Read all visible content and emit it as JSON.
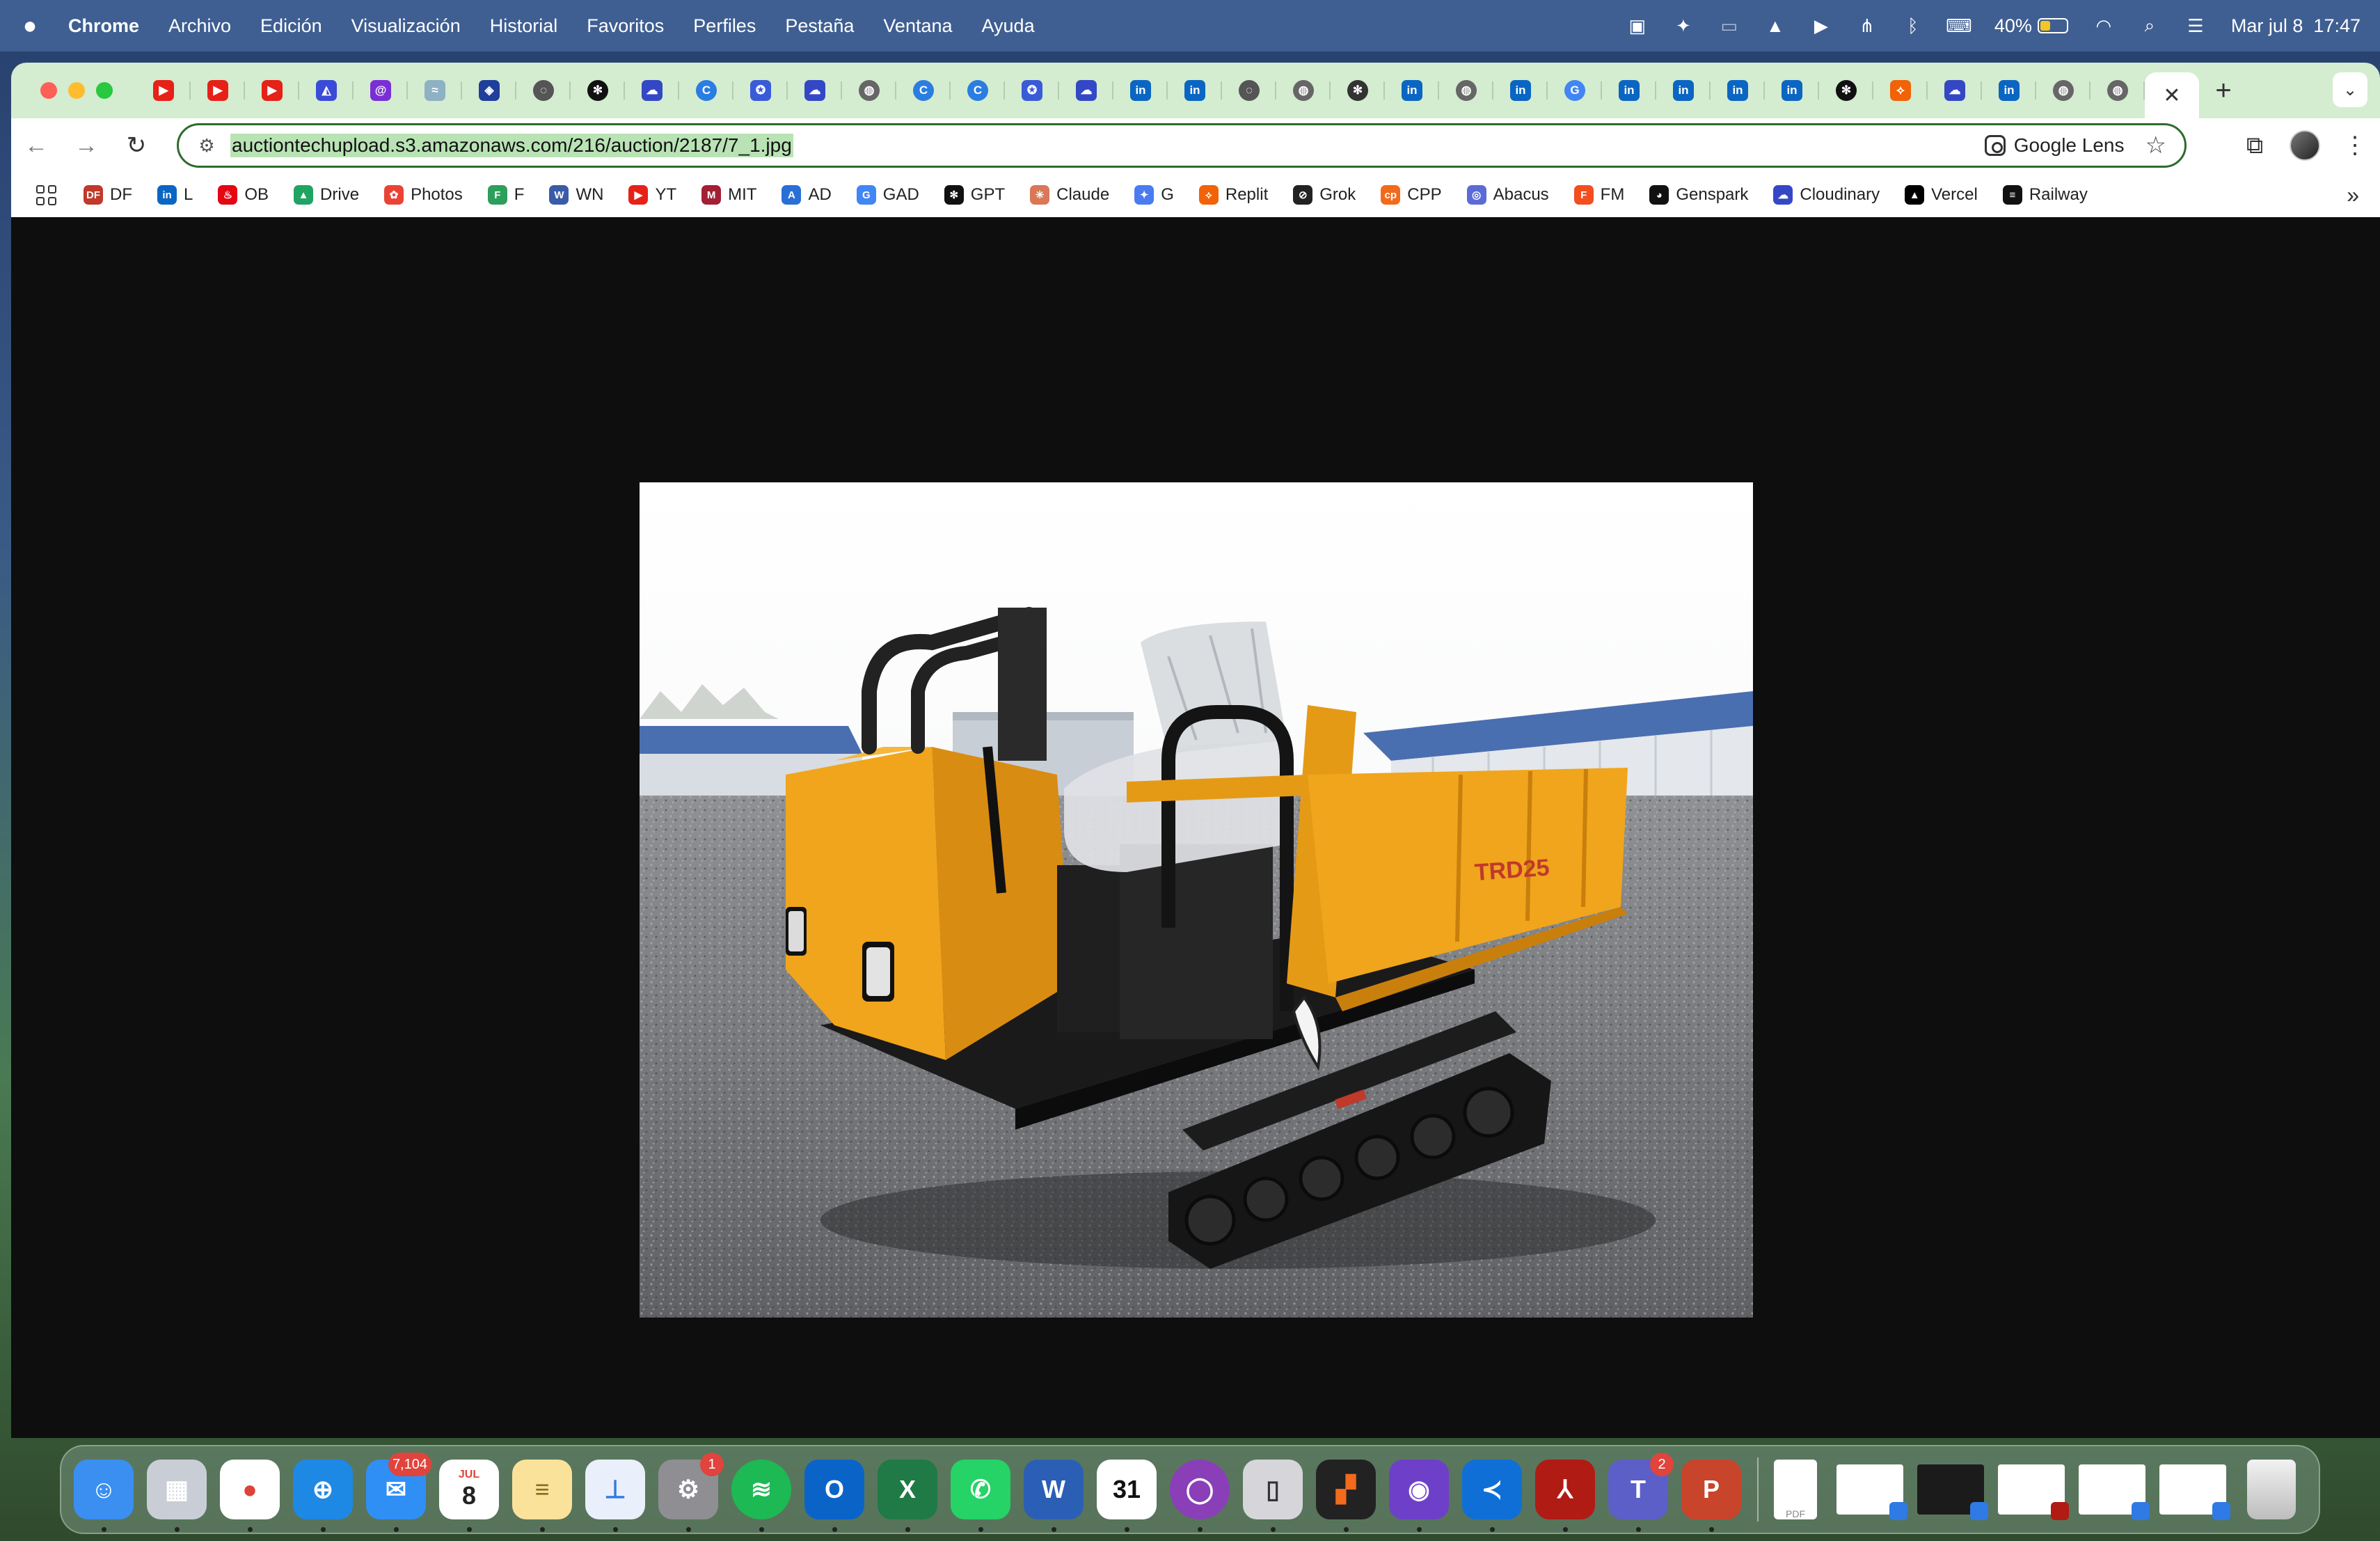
{
  "menubar": {
    "app_name": "Chrome",
    "menus": [
      "Archivo",
      "Edición",
      "Visualización",
      "Historial",
      "Favoritos",
      "Perfiles",
      "Pestaña",
      "Ventana",
      "Ayuda"
    ],
    "battery_percent": "40%",
    "battery_level": 0.4,
    "clock": "Mar jul 8  17:47"
  },
  "tabs": [
    {
      "icon": "youtube-icon",
      "color": "#e62117"
    },
    {
      "icon": "youtube-icon",
      "color": "#e62117"
    },
    {
      "icon": "youtube-icon",
      "color": "#e62117"
    },
    {
      "icon": "arc-icon",
      "color": "#3a4bd8"
    },
    {
      "icon": "spiral-icon",
      "color": "#7a2fd6"
    },
    {
      "icon": "wave-icon",
      "color": "#8fb1c4"
    },
    {
      "icon": "shield-app-icon",
      "color": "#1f3f9a"
    },
    {
      "icon": "loading-icon",
      "color": "#555555"
    },
    {
      "icon": "openai-icon",
      "color": "#111111"
    },
    {
      "icon": "cloudinary-icon",
      "color": "#3448c5"
    },
    {
      "icon": "c-app-icon",
      "color": "#2a7de1"
    },
    {
      "icon": "badge-icon",
      "color": "#3a5bd8"
    },
    {
      "icon": "cloudinary-icon",
      "color": "#3448c5"
    },
    {
      "icon": "globe-icon",
      "color": "#666666"
    },
    {
      "icon": "c-app-icon",
      "color": "#2a7de1"
    },
    {
      "icon": "c-app-icon",
      "color": "#2a7de1"
    },
    {
      "icon": "badge-icon",
      "color": "#3a5bd8"
    },
    {
      "icon": "cloudinary-icon",
      "color": "#3448c5"
    },
    {
      "icon": "linkedin-icon",
      "color": "#0a66c2"
    },
    {
      "icon": "linkedin-icon",
      "color": "#0a66c2"
    },
    {
      "icon": "loading-icon",
      "color": "#555555"
    },
    {
      "icon": "globe-icon",
      "color": "#666666"
    },
    {
      "icon": "openai-icon",
      "color": "#333333"
    },
    {
      "icon": "linkedin-icon",
      "color": "#0a66c2"
    },
    {
      "icon": "globe-icon",
      "color": "#666666"
    },
    {
      "icon": "linkedin-icon",
      "color": "#0a66c2"
    },
    {
      "icon": "google-icon",
      "color": "#4285f4"
    },
    {
      "icon": "linkedin-icon",
      "color": "#0a66c2"
    },
    {
      "icon": "linkedin-icon",
      "color": "#0a66c2"
    },
    {
      "icon": "linkedin-icon",
      "color": "#0a66c2"
    },
    {
      "icon": "linkedin-icon",
      "color": "#0a66c2"
    },
    {
      "icon": "openai-icon",
      "color": "#111111"
    },
    {
      "icon": "replit-icon",
      "color": "#f26207"
    },
    {
      "icon": "cloudinary-icon",
      "color": "#3448c5"
    },
    {
      "icon": "linkedin-icon",
      "color": "#0a66c2"
    },
    {
      "icon": "globe-icon",
      "color": "#666666"
    },
    {
      "icon": "globe-icon",
      "color": "#666666"
    }
  ],
  "address_bar": {
    "url": "auctiontechupload.s3.amazonaws.com/216/auction/2187/7_1.jpg",
    "lens_label": "Google Lens"
  },
  "bookmarks": [
    {
      "label": "DF",
      "icon": "df-icon",
      "color": "#c0392b"
    },
    {
      "label": "L",
      "icon": "linkedin-icon",
      "color": "#0a66c2"
    },
    {
      "label": "OB",
      "icon": "santander-icon",
      "color": "#e30613"
    },
    {
      "label": "Drive",
      "icon": "drive-icon",
      "color": "#1fa463"
    },
    {
      "label": "Photos",
      "icon": "photos-icon",
      "color": "#ea4335"
    },
    {
      "label": "F",
      "icon": "f-app-icon",
      "color": "#2e9e5b"
    },
    {
      "label": "WN",
      "icon": "wn-icon",
      "color": "#3a5ca8"
    },
    {
      "label": "YT",
      "icon": "youtube-icon",
      "color": "#e62117"
    },
    {
      "label": "MIT",
      "icon": "mit-icon",
      "color": "#a31f34"
    },
    {
      "label": "AD",
      "icon": "ad-icon",
      "color": "#2a6fd6"
    },
    {
      "label": "GAD",
      "icon": "google-icon",
      "color": "#4285f4"
    },
    {
      "label": "GPT",
      "icon": "openai-icon",
      "color": "#111111"
    },
    {
      "label": "Claude",
      "icon": "claude-icon",
      "color": "#d97757"
    },
    {
      "label": "G",
      "icon": "gemini-icon",
      "color": "#4a7cf0"
    },
    {
      "label": "Replit",
      "icon": "replit-icon",
      "color": "#f26207"
    },
    {
      "label": "Grok",
      "icon": "grok-icon",
      "color": "#222222"
    },
    {
      "label": "CPP",
      "icon": "cpp-icon",
      "color": "#f26a1b"
    },
    {
      "label": "Abacus",
      "icon": "abacus-icon",
      "color": "#5b6bd6"
    },
    {
      "label": "FM",
      "icon": "figma-icon",
      "color": "#f24e1e"
    },
    {
      "label": "Genspark",
      "icon": "genspark-icon",
      "color": "#111111"
    },
    {
      "label": "Cloudinary",
      "icon": "cloudinary-icon",
      "color": "#3448c5"
    },
    {
      "label": "Vercel",
      "icon": "vercel-icon",
      "color": "#000000"
    },
    {
      "label": "Railway",
      "icon": "railway-icon",
      "color": "#111111"
    }
  ],
  "image": {
    "alt": "Yellow tracked dumper with seat and tipping bed on gravel lot",
    "decal": "TRD25"
  },
  "dock": {
    "apps": [
      {
        "icon": "finder-icon",
        "bg": "#3a8ff0",
        "glyph": "☺"
      },
      {
        "icon": "launchpad-icon",
        "bg": "#c9ced6",
        "glyph": "▦"
      },
      {
        "icon": "chrome-icon",
        "bg": "#ffffff",
        "glyph": "●",
        "fg": "#db4437"
      },
      {
        "icon": "safari-icon",
        "bg": "#1e88e5",
        "glyph": "⊕"
      },
      {
        "icon": "mail-icon",
        "bg": "#2f8ff5",
        "glyph": "✉",
        "badge": "7,104"
      },
      {
        "icon": "calendar-icon",
        "bg": "#ffffff",
        "glyph": "8",
        "fg": "#222222",
        "label": "JUL"
      },
      {
        "icon": "notes-icon",
        "bg": "#fbe29a",
        "glyph": "≡",
        "fg": "#8a6d1a"
      },
      {
        "icon": "keynote-icon",
        "bg": "#e9f0fb",
        "glyph": "⊥",
        "fg": "#2f7ae5"
      },
      {
        "icon": "system-settings-icon",
        "bg": "#8e8e93",
        "glyph": "⚙",
        "badge": "1"
      },
      {
        "icon": "spotify-icon",
        "bg": "#1db954",
        "glyph": "≋",
        "round": true
      },
      {
        "icon": "outlook-icon",
        "bg": "#0a64c8",
        "glyph": "O"
      },
      {
        "icon": "excel-icon",
        "bg": "#1f7a45",
        "glyph": "X"
      },
      {
        "icon": "whatsapp-icon",
        "bg": "#25d366",
        "glyph": "✆"
      },
      {
        "icon": "word-icon",
        "bg": "#2b5fb5",
        "glyph": "W"
      },
      {
        "icon": "fantastical-icon",
        "bg": "#ffffff",
        "glyph": "31",
        "fg": "#111111"
      },
      {
        "icon": "circle-app-icon",
        "bg": "#8a3fb8",
        "glyph": "◯",
        "round": true
      },
      {
        "icon": "iphone-mirroring-icon",
        "bg": "#d6d6da",
        "glyph": "▯",
        "fg": "#333333"
      },
      {
        "icon": "blocks-app-icon",
        "bg": "#222222",
        "glyph": "▞",
        "fg": "#f26a1b"
      },
      {
        "icon": "github-desktop-icon",
        "bg": "#6e40c9",
        "glyph": "◉"
      },
      {
        "icon": "vscode-icon",
        "bg": "#0f6fd6",
        "glyph": "≺"
      },
      {
        "icon": "acrobat-icon",
        "bg": "#b01b14",
        "glyph": "⅄"
      },
      {
        "icon": "teams-icon",
        "bg": "#5b5fc7",
        "glyph": "T",
        "badge": "2"
      },
      {
        "icon": "powerpoint-icon",
        "bg": "#c8442b",
        "glyph": "P"
      }
    ],
    "files": [
      {
        "icon": "pdf-file-icon",
        "label": "PDF"
      },
      {
        "icon": "screenshot-thumb-icon"
      },
      {
        "icon": "terminal-thumb-icon"
      },
      {
        "icon": "document-thumb-icon"
      },
      {
        "icon": "screenshot-thumb-icon"
      },
      {
        "icon": "screenshot-thumb-icon"
      },
      {
        "icon": "trash-icon"
      }
    ]
  }
}
